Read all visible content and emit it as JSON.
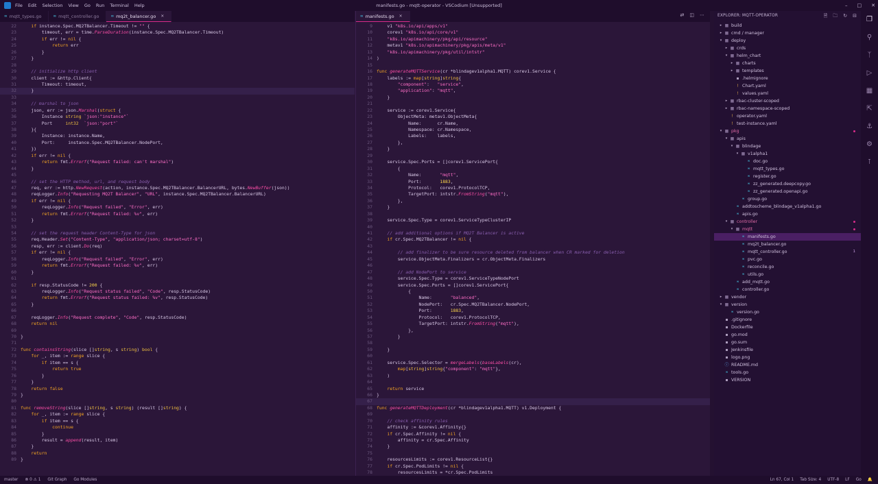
{
  "window": {
    "title": "manifests.go - mqtt-operator - VSCodium [Unsupported]",
    "menu": [
      "File",
      "Edit",
      "Selection",
      "View",
      "Go",
      "Run",
      "Terminal",
      "Help"
    ]
  },
  "left_group": {
    "tabs": [
      {
        "label": "mqtt_types.go",
        "active": false
      },
      {
        "label": "mqtt_controller.go",
        "active": false
      },
      {
        "label": "mq2t_balancer.go",
        "active": true
      }
    ],
    "lines": [
      {
        "n": "22",
        "t": "    if instance.Spec.MQ2TBalancer.Timeout != \"\" {"
      },
      {
        "n": "23",
        "t": "        timeout, err = time.ParseDuration(instance.Spec.MQ2TBalancer.Timeout)"
      },
      {
        "n": "24",
        "t": "        if err != nil {"
      },
      {
        "n": "25",
        "t": "            return err"
      },
      {
        "n": "26",
        "t": "        }"
      },
      {
        "n": "27",
        "t": "    }"
      },
      {
        "n": "28",
        "t": ""
      },
      {
        "n": "29",
        "t": "    // initialize http client"
      },
      {
        "n": "30",
        "t": "    client := &http.Client{"
      },
      {
        "n": "31",
        "t": "        Timeout: timeout,"
      },
      {
        "n": "32",
        "t": "    }"
      },
      {
        "n": "33",
        "t": ""
      },
      {
        "n": "34",
        "t": "    // marshal to json"
      },
      {
        "n": "35",
        "t": "    json, err := json.Marshal(struct {"
      },
      {
        "n": "36",
        "t": "        Instance string `json:\"instance\"`"
      },
      {
        "n": "37",
        "t": "        Port     int32  `json:\"port\"`"
      },
      {
        "n": "38",
        "t": "    }{"
      },
      {
        "n": "39",
        "t": "        Instance: instance.Name,"
      },
      {
        "n": "40",
        "t": "        Port:     instance.Spec.MQ2TBalancer.NodePort,"
      },
      {
        "n": "41",
        "t": "    })"
      },
      {
        "n": "42",
        "t": "    if err != nil {"
      },
      {
        "n": "43",
        "t": "        return fmt.Errorf(\"Request failed: can't marshal\")"
      },
      {
        "n": "44",
        "t": "    }"
      },
      {
        "n": "45",
        "t": ""
      },
      {
        "n": "46",
        "t": "    // set the HTTP method, url, and request body"
      },
      {
        "n": "47",
        "t": "    req, err := http.NewRequest(action, instance.Spec.MQ2TBalancer.BalancerURL, bytes.NewBuffer(json))"
      },
      {
        "n": "48",
        "t": "    reqLogger.Info(\"Requesting MQ2T Balancer\", \"URL\", instance.Spec.MQ2TBalancer.BalancerURL)"
      },
      {
        "n": "49",
        "t": "    if err != nil {"
      },
      {
        "n": "50",
        "t": "        reqLogger.Info(\"Request failed\", \"Error\", err)"
      },
      {
        "n": "51",
        "t": "        return fmt.Errorf(\"Request failed: %v\", err)"
      },
      {
        "n": "52",
        "t": "    }"
      },
      {
        "n": "53",
        "t": ""
      },
      {
        "n": "54",
        "t": "    // set the request header Content-Type for json"
      },
      {
        "n": "55",
        "t": "    req.Header.Set(\"Content-Type\", \"application/json; charset=utf-8\")"
      },
      {
        "n": "56",
        "t": "    resp, err := client.Do(req)"
      },
      {
        "n": "57",
        "t": "    if err != nil {"
      },
      {
        "n": "58",
        "t": "        reqLogger.Info(\"Request failed\", \"Error\", err)"
      },
      {
        "n": "59",
        "t": "        return fmt.Errorf(\"Request failed: %v\", err)"
      },
      {
        "n": "60",
        "t": "    }"
      },
      {
        "n": "61",
        "t": ""
      },
      {
        "n": "62",
        "t": "    if resp.StatusCode != 200 {"
      },
      {
        "n": "63",
        "t": "        reqLogger.Info(\"Request status failed\", \"Code\", resp.StatusCode)"
      },
      {
        "n": "64",
        "t": "        return fmt.Errorf(\"Request status failed: %v\", resp.StatusCode)"
      },
      {
        "n": "65",
        "t": "    }"
      },
      {
        "n": "66",
        "t": ""
      },
      {
        "n": "67",
        "t": "    reqLogger.Info(\"Request complete\", \"Code\", resp.StatusCode)"
      },
      {
        "n": "68",
        "t": "    return nil"
      },
      {
        "n": "69",
        "t": ""
      },
      {
        "n": "70",
        "t": "}"
      },
      {
        "n": "71",
        "t": ""
      },
      {
        "n": "72",
        "t": "func containsString(slice []string, s string) bool {"
      },
      {
        "n": "73",
        "t": "    for _, item := range slice {"
      },
      {
        "n": "74",
        "t": "        if item == s {"
      },
      {
        "n": "75",
        "t": "            return true"
      },
      {
        "n": "76",
        "t": "        }"
      },
      {
        "n": "77",
        "t": "    }"
      },
      {
        "n": "78",
        "t": "    return false"
      },
      {
        "n": "79",
        "t": "}"
      },
      {
        "n": "80",
        "t": ""
      },
      {
        "n": "81",
        "t": "func removeString(slice []string, s string) (result []string) {"
      },
      {
        "n": "82",
        "t": "    for _, item := range slice {"
      },
      {
        "n": "83",
        "t": "        if item == s {"
      },
      {
        "n": "84",
        "t": "            continue"
      },
      {
        "n": "85",
        "t": "        }"
      },
      {
        "n": "86",
        "t": "        result = append(result, item)"
      },
      {
        "n": "87",
        "t": "    }"
      },
      {
        "n": "88",
        "t": "    return"
      },
      {
        "n": "89",
        "t": "}"
      }
    ]
  },
  "right_group": {
    "tabs": [
      {
        "label": "manifests.go",
        "active": true
      }
    ],
    "lines": [
      {
        "n": "9",
        "t": "    v1 \"k8s.io/api/apps/v1\""
      },
      {
        "n": "10",
        "t": "    corev1 \"k8s.io/api/core/v1\""
      },
      {
        "n": "11",
        "t": "    \"k8s.io/apimachinery/pkg/api/resource\""
      },
      {
        "n": "12",
        "t": "    metav1 \"k8s.io/apimachinery/pkg/apis/meta/v1\""
      },
      {
        "n": "13",
        "t": "    \"k8s.io/apimachinery/pkg/util/intstr\""
      },
      {
        "n": "14",
        "t": ")"
      },
      {
        "n": "15",
        "t": ""
      },
      {
        "n": "16",
        "t": "func generateMQTTService(cr *blindagev1alpha1.MQTT) corev1.Service {"
      },
      {
        "n": "17",
        "t": "    labels := map[string]string{"
      },
      {
        "n": "18",
        "t": "        \"component\":   \"service\","
      },
      {
        "n": "19",
        "t": "        \"application\": \"mqtt\","
      },
      {
        "n": "20",
        "t": "    }"
      },
      {
        "n": "21",
        "t": ""
      },
      {
        "n": "22",
        "t": "    service := corev1.Service{"
      },
      {
        "n": "23",
        "t": "        ObjectMeta: metav1.ObjectMeta{"
      },
      {
        "n": "24",
        "t": "            Name:      cr.Name,"
      },
      {
        "n": "25",
        "t": "            Namespace: cr.Namespace,"
      },
      {
        "n": "26",
        "t": "            Labels:    labels,"
      },
      {
        "n": "27",
        "t": "        },"
      },
      {
        "n": "28",
        "t": "    }"
      },
      {
        "n": "29",
        "t": ""
      },
      {
        "n": "30",
        "t": "    service.Spec.Ports = []corev1.ServicePort{"
      },
      {
        "n": "31",
        "t": "        {"
      },
      {
        "n": "32",
        "t": "            Name:       \"mqtt\","
      },
      {
        "n": "33",
        "t": "            Port:       1883,"
      },
      {
        "n": "34",
        "t": "            Protocol:   corev1.ProtocolTCP,"
      },
      {
        "n": "35",
        "t": "            TargetPort: intstr.FromString(\"mqtt\"),"
      },
      {
        "n": "36",
        "t": "        },"
      },
      {
        "n": "37",
        "t": "    }"
      },
      {
        "n": "38",
        "t": ""
      },
      {
        "n": "39",
        "t": "    service.Spec.Type = corev1.ServiceTypeClusterIP"
      },
      {
        "n": "40",
        "t": ""
      },
      {
        "n": "41",
        "t": "    // add additional options if MQ2T Balancer is active"
      },
      {
        "n": "42",
        "t": "    if cr.Spec.MQ2TBalancer != nil {"
      },
      {
        "n": "43",
        "t": ""
      },
      {
        "n": "44",
        "t": "        // add finalizer to be sure resource deleted from balancer when CR marked for deletion"
      },
      {
        "n": "45",
        "t": "        service.ObjectMeta.Finalizers = cr.ObjectMeta.Finalizers"
      },
      {
        "n": "46",
        "t": ""
      },
      {
        "n": "47",
        "t": "        // add NodePort to service"
      },
      {
        "n": "48",
        "t": "        service.Spec.Type = corev1.ServiceTypeNodePort"
      },
      {
        "n": "49",
        "t": "        service.Spec.Ports = []corev1.ServicePort{"
      },
      {
        "n": "50",
        "t": "            {"
      },
      {
        "n": "51",
        "t": "                Name:       \"balanced\","
      },
      {
        "n": "52",
        "t": "                NodePort:   cr.Spec.MQ2TBalancer.NodePort,"
      },
      {
        "n": "53",
        "t": "                Port:       1883,"
      },
      {
        "n": "54",
        "t": "                Protocol:   corev1.ProtocolTCP,"
      },
      {
        "n": "55",
        "t": "                TargetPort: intstr.FromString(\"mqtt\"),"
      },
      {
        "n": "56",
        "t": "            },"
      },
      {
        "n": "57",
        "t": "        }"
      },
      {
        "n": "58",
        "t": ""
      },
      {
        "n": "59",
        "t": "    }"
      },
      {
        "n": "60",
        "t": ""
      },
      {
        "n": "61",
        "t": "    service.Spec.Selector = mergeLabels(baseLabels(cr),"
      },
      {
        "n": "62",
        "t": "        map[string]string{\"component\": \"mqtt\"},"
      },
      {
        "n": "63",
        "t": "    )"
      },
      {
        "n": "64",
        "t": ""
      },
      {
        "n": "65",
        "t": "    return service"
      },
      {
        "n": "66",
        "t": "}"
      },
      {
        "n": "67",
        "t": ""
      },
      {
        "n": "68",
        "t": "func generateMQTTDeployment(cr *blindagev1alpha1.MQTT) v1.Deployment {"
      },
      {
        "n": "69",
        "t": ""
      },
      {
        "n": "70",
        "t": "    // check affinity rules"
      },
      {
        "n": "71",
        "t": "    affinity := &corev1.Affinity{}"
      },
      {
        "n": "72",
        "t": "    if cr.Spec.Affinity != nil {"
      },
      {
        "n": "73",
        "t": "        affinity = cr.Spec.Affinity"
      },
      {
        "n": "74",
        "t": "    }"
      },
      {
        "n": "75",
        "t": ""
      },
      {
        "n": "76",
        "t": "    resourcesLimits := corev1.ResourceList{}"
      },
      {
        "n": "77",
        "t": "    if cr.Spec.PodLimits != nil {"
      },
      {
        "n": "78",
        "t": "        resourcesLimits = *cr.Spec.PodLimits"
      }
    ]
  },
  "explorer": {
    "title": "EXPLORER: MQTT-OPERATOR",
    "items": [
      {
        "label": "build",
        "depth": 0,
        "kind": "folder",
        "open": false
      },
      {
        "label": "cmd / manager",
        "depth": 0,
        "kind": "folder",
        "open": false
      },
      {
        "label": "deploy",
        "depth": 0,
        "kind": "folder",
        "open": true
      },
      {
        "label": "crds",
        "depth": 1,
        "kind": "folder",
        "open": false
      },
      {
        "label": "helm_chart",
        "depth": 1,
        "kind": "folder",
        "open": true
      },
      {
        "label": "charts",
        "depth": 2,
        "kind": "folder",
        "open": false
      },
      {
        "label": "templates",
        "depth": 2,
        "kind": "folder",
        "open": false
      },
      {
        "label": ".helmignore",
        "depth": 2,
        "kind": "other"
      },
      {
        "label": "Chart.yaml",
        "depth": 2,
        "kind": "yaml"
      },
      {
        "label": "values.yaml",
        "depth": 2,
        "kind": "yaml"
      },
      {
        "label": "rbac-cluster-scoped",
        "depth": 1,
        "kind": "folder",
        "open": false
      },
      {
        "label": "rbac-namespace-scoped",
        "depth": 1,
        "kind": "folder",
        "open": false
      },
      {
        "label": "operator.yaml",
        "depth": 1,
        "kind": "yaml"
      },
      {
        "label": "test-instance.yaml",
        "depth": 1,
        "kind": "yaml"
      },
      {
        "label": "pkg",
        "depth": 0,
        "kind": "folder",
        "open": true,
        "modified": true
      },
      {
        "label": "apis",
        "depth": 1,
        "kind": "folder",
        "open": true
      },
      {
        "label": "blindage",
        "depth": 2,
        "kind": "folder",
        "open": true
      },
      {
        "label": "v1alpha1",
        "depth": 3,
        "kind": "folder",
        "open": true
      },
      {
        "label": "doc.go",
        "depth": 4,
        "kind": "go"
      },
      {
        "label": "mqtt_types.go",
        "depth": 4,
        "kind": "go"
      },
      {
        "label": "register.go",
        "depth": 4,
        "kind": "go"
      },
      {
        "label": "zz_generated.deepcopy.go",
        "depth": 4,
        "kind": "go"
      },
      {
        "label": "zz_generated.openapi.go",
        "depth": 4,
        "kind": "go"
      },
      {
        "label": "group.go",
        "depth": 3,
        "kind": "go"
      },
      {
        "label": "addtoscheme_blindage_v1alpha1.go",
        "depth": 2,
        "kind": "go"
      },
      {
        "label": "apis.go",
        "depth": 2,
        "kind": "go"
      },
      {
        "label": "controller",
        "depth": 1,
        "kind": "folder",
        "open": true,
        "modified": true
      },
      {
        "label": "mqtt",
        "depth": 2,
        "kind": "folder",
        "open": true,
        "modified": true
      },
      {
        "label": "manifests.go",
        "depth": 3,
        "kind": "go",
        "selected": true
      },
      {
        "label": "mq2t_balancer.go",
        "depth": 3,
        "kind": "go"
      },
      {
        "label": "mqtt_controller.go",
        "depth": 3,
        "kind": "go",
        "badge": "1"
      },
      {
        "label": "pvc.go",
        "depth": 3,
        "kind": "go"
      },
      {
        "label": "reconcile.go",
        "depth": 3,
        "kind": "go"
      },
      {
        "label": "utils.go",
        "depth": 3,
        "kind": "go"
      },
      {
        "label": "add_mqtt.go",
        "depth": 2,
        "kind": "go"
      },
      {
        "label": "controller.go",
        "depth": 2,
        "kind": "go"
      },
      {
        "label": "vendor",
        "depth": 0,
        "kind": "folder",
        "open": false
      },
      {
        "label": "version",
        "depth": 0,
        "kind": "folder",
        "open": true
      },
      {
        "label": "version.go",
        "depth": 1,
        "kind": "go"
      },
      {
        "label": ".gitignore",
        "depth": 0,
        "kind": "other"
      },
      {
        "label": "Dockerfile",
        "depth": 0,
        "kind": "other"
      },
      {
        "label": "go.mod",
        "depth": 0,
        "kind": "other"
      },
      {
        "label": "go.sum",
        "depth": 0,
        "kind": "other"
      },
      {
        "label": "Jenkinsfile",
        "depth": 0,
        "kind": "other"
      },
      {
        "label": "logo.png",
        "depth": 0,
        "kind": "other"
      },
      {
        "label": "README.md",
        "depth": 0,
        "kind": "md"
      },
      {
        "label": "tools.go",
        "depth": 0,
        "kind": "go"
      },
      {
        "label": "VERSION",
        "depth": 0,
        "kind": "other"
      }
    ]
  },
  "status": {
    "branch": "master",
    "problems": "⊗ 0  ⚠ 1",
    "git_graph": "Git Graph",
    "go_modules": "Go Modules",
    "position": "Ln 67, Col 1",
    "tab_size": "Tab Size: 4",
    "encoding": "UTF-8",
    "eol": "LF",
    "language": "Go"
  },
  "colors": {
    "keyword": "#f5a623",
    "func": "#ff4fa8",
    "string": "#ff6ec7",
    "comment": "#8a5fb0",
    "type": "#f0c040",
    "number": "#ffd84a",
    "accent": "#d92b8a"
  }
}
